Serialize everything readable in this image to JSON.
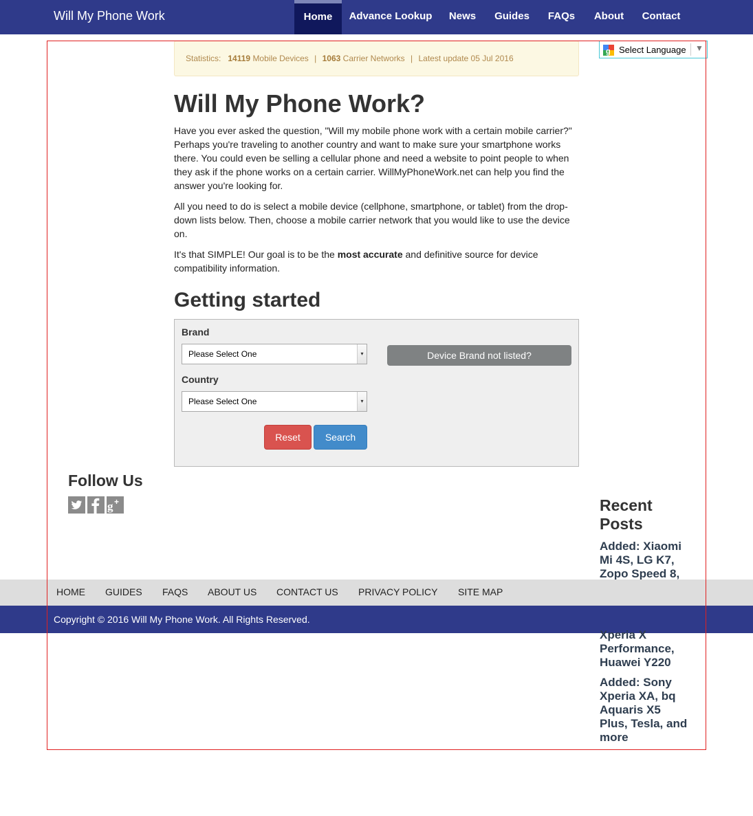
{
  "navbar": {
    "brand": "Will My Phone Work",
    "items": [
      {
        "label": "Home",
        "active": true
      },
      {
        "label": "Advance Lookup"
      },
      {
        "label": "News"
      },
      {
        "label": "Guides"
      },
      {
        "label": "FAQs"
      },
      {
        "label": "About"
      },
      {
        "label": "Contact"
      }
    ]
  },
  "translate": {
    "label": "Select Language",
    "arrow": "▼"
  },
  "stats": {
    "prefix": "Statistics:",
    "devices_count": "14119",
    "devices_label": "Mobile Devices",
    "separator": "|",
    "networks_count": "1063",
    "networks_label": "Carrier Networks",
    "update": "Latest update 05 Jul 2016"
  },
  "main": {
    "title": "Will My Phone Work?",
    "para1": "Have you ever asked the question, \"Will my mobile phone work with a certain mobile carrier?\" Perhaps you're traveling to another country and want to make sure your smartphone works there. You could even be selling a cellular phone and need a website to point people to when they ask if the phone works on a certain carrier. WillMyPhoneWork.net can help you find the answer you're looking for.",
    "para2": "All you need to do is select a mobile device (cellphone, smartphone, or tablet) from the drop-down lists below. Then, choose a mobile carrier network that you would like to use the device on.",
    "para3_before": "It's that SIMPLE! Our goal is to be the ",
    "para3_bold": "most accurate",
    "para3_after": " and definitive source for device compatibility information.",
    "section_title": "Getting started"
  },
  "form": {
    "brand_label": "Brand",
    "brand_value": "Please Select One",
    "country_label": "Country",
    "country_value": "Please Select One",
    "not_listed_label": "Device Brand not listed?",
    "reset_label": "Reset",
    "search_label": "Search",
    "select_arrow": "▾"
  },
  "follow": {
    "title": "Follow Us",
    "icons": [
      "twitter-icon",
      "facebook-icon",
      "google-plus-icon"
    ],
    "twitter_glyph": "🐦",
    "facebook_glyph": "f",
    "gplus_glyph": "g+"
  },
  "recent": {
    "title": "Recent Posts",
    "posts": [
      "Added: Xiaomi Mi 4S, LG K7, Zopo Speed 8,",
      "Xperia X Performance, Huawei Y220",
      "Added: Sony Xperia XA, bq Aquaris X5 Plus, Tesla, and more"
    ]
  },
  "footer": {
    "nav": [
      "HOME",
      "GUIDES",
      "FAQS",
      "ABOUT US",
      "CONTACT US",
      "PRIVACY POLICY",
      "SITE MAP"
    ],
    "copyright": "Copyright © 2016 Will My Phone Work. All Rights Reserved."
  },
  "colors": {
    "navbar": "#2f3a8a",
    "nav_active": "#10185c",
    "reset": "#d9534f",
    "search": "#428bca",
    "stats_bg": "#fcf8e3"
  }
}
